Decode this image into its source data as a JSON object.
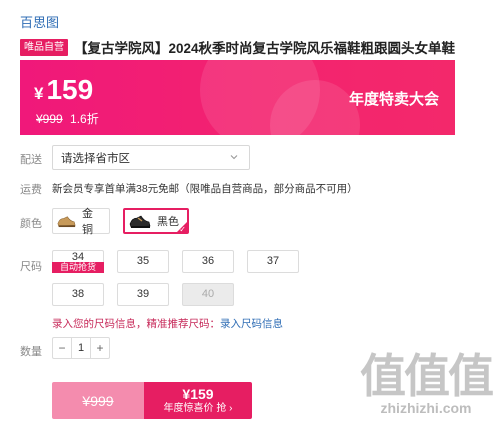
{
  "brand": "百思图",
  "product": {
    "badge": "唯品自营",
    "title": "【复古学院风】2024秋季时尚复古学院风乐福鞋粗跟圆头女单鞋"
  },
  "price": {
    "currency": "¥",
    "current": "159",
    "original": "¥999",
    "discount": "1.6折",
    "sale_name": "年度特卖大会"
  },
  "delivery": {
    "label": "配送",
    "placeholder": "请选择省市区"
  },
  "shipping": {
    "label": "运费",
    "text": "新会员专享首单满38元免邮（限唯品自营商品，部分商品不可用）"
  },
  "color": {
    "label": "颜色",
    "options": [
      {
        "name": "金铜",
        "selected": false
      },
      {
        "name": "黑色",
        "selected": true
      }
    ]
  },
  "size": {
    "label": "尺码",
    "options": [
      "34",
      "35",
      "36",
      "37",
      "38",
      "39",
      "40"
    ],
    "tag": "自动抢货",
    "note_prefix": "录入您的尺码信息，精准推荐尺码：",
    "note_link": "录入尺码信息"
  },
  "quantity": {
    "label": "数量",
    "minus": "−",
    "value": "1",
    "plus": "+"
  },
  "buy": {
    "old_price": "¥999",
    "new_price": "¥159",
    "action": "年度惊喜价 抢 ›"
  },
  "watermark": {
    "logo": "值值值",
    "url": "zhizhizhi.com"
  },
  "colors": {
    "accent": "#e61e62",
    "banner": "#f0187a",
    "link": "#2f6db5"
  }
}
